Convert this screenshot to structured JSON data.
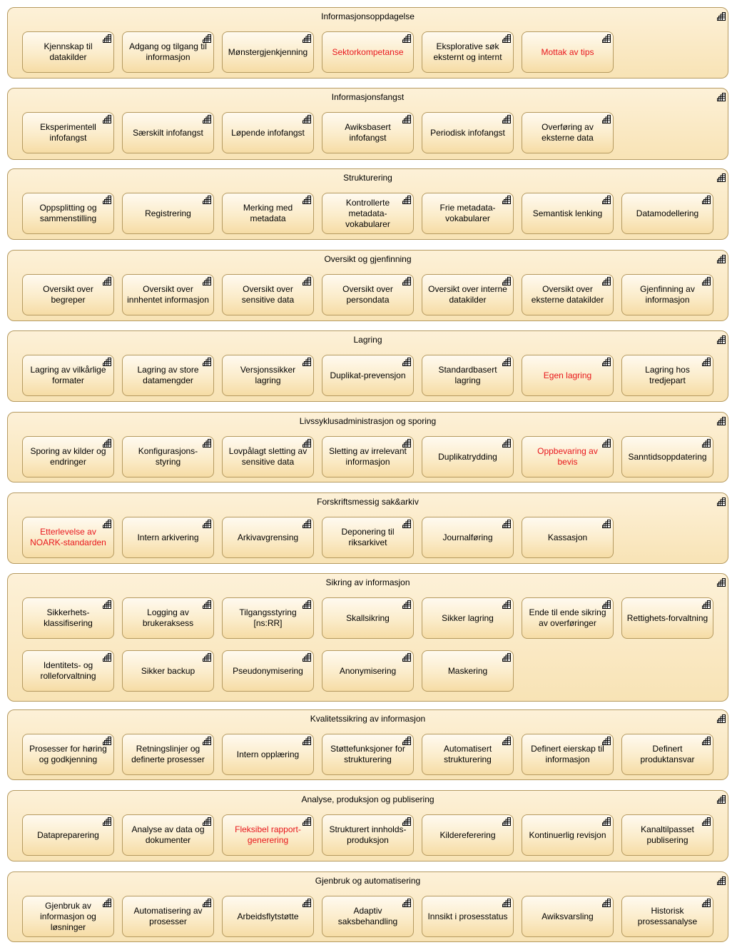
{
  "groups": [
    {
      "title": "Informasjonsoppdagelse",
      "items": [
        {
          "label": "Kjennskap til datakilder",
          "highlight": false
        },
        {
          "label": "Adgang og tilgang til informasjon",
          "highlight": false
        },
        {
          "label": "Mønstergjenkjenning",
          "highlight": false
        },
        {
          "label": "Sektorkompetanse",
          "highlight": true
        },
        {
          "label": "Eksplorative søk eksternt og internt",
          "highlight": false
        },
        {
          "label": "Mottak av tips",
          "highlight": true
        }
      ]
    },
    {
      "title": "Informasjonsfangst",
      "items": [
        {
          "label": "Eksperimentell infofangst",
          "highlight": false
        },
        {
          "label": "Særskilt infofangst",
          "highlight": false
        },
        {
          "label": "Løpende infofangst",
          "highlight": false
        },
        {
          "label": "Awiksbasert infofangst",
          "highlight": false
        },
        {
          "label": "Periodisk infofangst",
          "highlight": false
        },
        {
          "label": "Overføring av eksterne data",
          "highlight": false
        }
      ]
    },
    {
      "title": "Strukturering",
      "items": [
        {
          "label": "Oppsplitting og sammenstilling",
          "highlight": false
        },
        {
          "label": "Registrering",
          "highlight": false
        },
        {
          "label": "Merking med metadata",
          "highlight": false
        },
        {
          "label": "Kontrollerte metadata-vokabularer",
          "highlight": false
        },
        {
          "label": "Frie metadata-vokabularer",
          "highlight": false
        },
        {
          "label": "Semantisk lenking",
          "highlight": false
        },
        {
          "label": "Datamodellering",
          "highlight": false
        }
      ]
    },
    {
      "title": "Oversikt og gjenfinning",
      "items": [
        {
          "label": "Oversikt over begreper",
          "highlight": false
        },
        {
          "label": "Oversikt over innhentet informasjon",
          "highlight": false
        },
        {
          "label": "Oversikt over sensitive data",
          "highlight": false
        },
        {
          "label": "Oversikt over persondata",
          "highlight": false
        },
        {
          "label": "Oversikt over interne datakilder",
          "highlight": false
        },
        {
          "label": "Oversikt over eksterne datakilder",
          "highlight": false
        },
        {
          "label": "Gjenfinning av informasjon",
          "highlight": false
        }
      ]
    },
    {
      "title": "Lagring",
      "items": [
        {
          "label": "Lagring av vilkårlige formater",
          "highlight": false
        },
        {
          "label": "Lagring av store datamengder",
          "highlight": false
        },
        {
          "label": "Versjonssikker lagring",
          "highlight": false
        },
        {
          "label": "Duplikat-prevensjon",
          "highlight": false
        },
        {
          "label": "Standardbasert lagring",
          "highlight": false
        },
        {
          "label": "Egen lagring",
          "highlight": true
        },
        {
          "label": "Lagring hos tredjepart",
          "highlight": false
        }
      ]
    },
    {
      "title": "Livssyklusadministrasjon og sporing",
      "items": [
        {
          "label": "Sporing av kilder og endringer",
          "highlight": false
        },
        {
          "label": "Konfigurasjons-styring",
          "highlight": false
        },
        {
          "label": "Lovpålagt sletting av sensitive data",
          "highlight": false
        },
        {
          "label": "Sletting av irrelevant informasjon",
          "highlight": false
        },
        {
          "label": "Duplikatrydding",
          "highlight": false
        },
        {
          "label": "Oppbevaring av bevis",
          "highlight": true
        },
        {
          "label": "Sanntidsoppdatering",
          "highlight": false
        }
      ]
    },
    {
      "title": "Forskriftsmessig sak&arkiv",
      "items": [
        {
          "label": "Etterlevelse av NOARK-standarden",
          "highlight": true
        },
        {
          "label": "Intern arkivering",
          "highlight": false
        },
        {
          "label": "Arkivavgrensing",
          "highlight": false
        },
        {
          "label": "Deponering til riksarkivet",
          "highlight": false
        },
        {
          "label": "Journalføring",
          "highlight": false
        },
        {
          "label": "Kassasjon",
          "highlight": false
        }
      ]
    },
    {
      "title": "Sikring av informasjon",
      "items": [
        {
          "label": "Sikkerhets-klassifisering",
          "highlight": false
        },
        {
          "label": "Logging av brukeraksess",
          "highlight": false
        },
        {
          "label": "Tilgangsstyring [ns:RR]",
          "highlight": false
        },
        {
          "label": "Skallsikring",
          "highlight": false
        },
        {
          "label": "Sikker lagring",
          "highlight": false
        },
        {
          "label": "Ende til ende sikring av overføringer",
          "highlight": false
        },
        {
          "label": "Rettighets-forvaltning",
          "highlight": false
        },
        {
          "label": "Identitets- og rolleforvaltning",
          "highlight": false
        },
        {
          "label": "Sikker backup",
          "highlight": false
        },
        {
          "label": "Pseudonymisering",
          "highlight": false
        },
        {
          "label": "Anonymisering",
          "highlight": false
        },
        {
          "label": "Maskering",
          "highlight": false
        }
      ]
    },
    {
      "title": "Kvalitetssikring av informasjon",
      "items": [
        {
          "label": "Prosesser for høring og godkjenning",
          "highlight": false
        },
        {
          "label": "Retningslinjer og definerte prosesser",
          "highlight": false
        },
        {
          "label": "Intern opplæring",
          "highlight": false
        },
        {
          "label": "Støttefunksjoner for strukturering",
          "highlight": false
        },
        {
          "label": "Automatisert strukturering",
          "highlight": false
        },
        {
          "label": "Definert eierskap til informasjon",
          "highlight": false
        },
        {
          "label": "Definert produktansvar",
          "highlight": false
        }
      ]
    },
    {
      "title": "Analyse, produksjon og publisering",
      "items": [
        {
          "label": "Datapreparering",
          "highlight": false
        },
        {
          "label": "Analyse av data og dokumenter",
          "highlight": false
        },
        {
          "label": "Fleksibel rapport-generering",
          "highlight": true
        },
        {
          "label": "Strukturert innholds-produksjon",
          "highlight": false
        },
        {
          "label": "Kildereferering",
          "highlight": false
        },
        {
          "label": "Kontinuerlig revisjon",
          "highlight": false
        },
        {
          "label": "Kanaltilpasset publisering",
          "highlight": false
        }
      ]
    },
    {
      "title": "Gjenbruk og automatisering",
      "items": [
        {
          "label": "Gjenbruk av informasjon og løsninger",
          "highlight": false
        },
        {
          "label": "Automatisering av prosesser",
          "highlight": false
        },
        {
          "label": "Arbeidsflytstøtte",
          "highlight": false
        },
        {
          "label": "Adaptiv saksbehandling",
          "highlight": false
        },
        {
          "label": "Innsikt i prosesstatus",
          "highlight": false
        },
        {
          "label": "Awiksvarsling",
          "highlight": false
        },
        {
          "label": "Historisk prosessanalyse",
          "highlight": false
        }
      ]
    }
  ],
  "icon": "capability-stairs-icon",
  "colors": {
    "highlight_text": "#e8161b",
    "border": "#b59a60",
    "fill": "#f8e3b5"
  }
}
